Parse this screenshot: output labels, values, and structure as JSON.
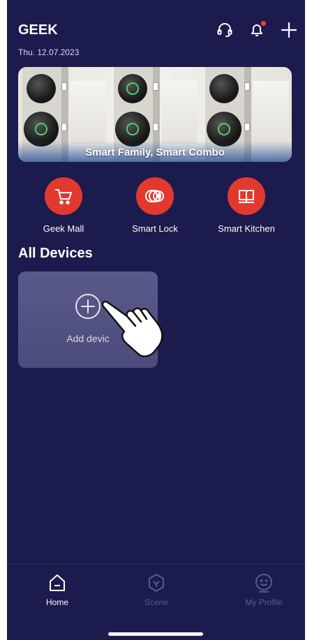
{
  "header": {
    "app_title": "GEEK",
    "date": "Thu. 12.07.2023",
    "icons": [
      "headset-icon",
      "bell-icon",
      "plus-icon"
    ],
    "notification_dot": true
  },
  "banner": {
    "caption": "Smart Family, Smart Combo"
  },
  "shortcuts": [
    {
      "label": "Geek Mall",
      "icon": "cart-icon"
    },
    {
      "label": "Smart Lock",
      "icon": "lock-icon"
    },
    {
      "label": "Smart Kitchen",
      "icon": "book-icon"
    }
  ],
  "devices": {
    "title": "All Devices",
    "add_label": "Add devic"
  },
  "tabs": [
    {
      "label": "Home",
      "icon": "home-icon",
      "active": true
    },
    {
      "label": "Scene",
      "icon": "scene-icon",
      "active": false
    },
    {
      "label": "My Profile",
      "icon": "profile-icon",
      "active": false
    }
  ],
  "colors": {
    "background": "#1c1b4e",
    "accent_red": "#e2392f",
    "card": "#55558a",
    "inactive_tab": "#5b5a8c"
  }
}
